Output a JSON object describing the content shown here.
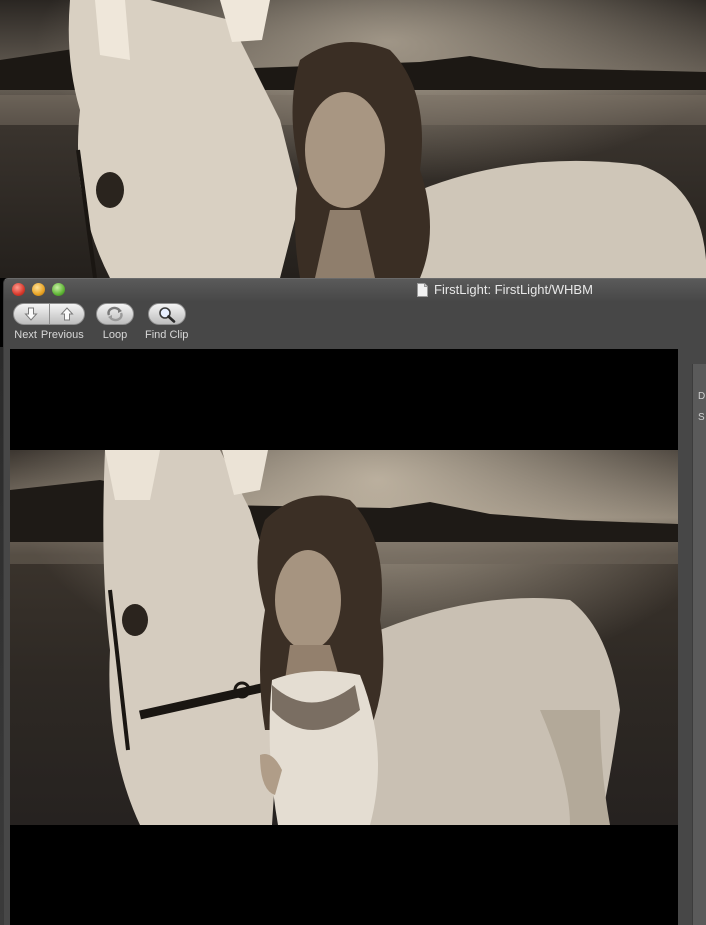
{
  "window": {
    "title": "FirstLight: FirstLight/WHBM"
  },
  "toolbar": {
    "next_label": "Next",
    "previous_label": "Previous",
    "loop_label": "Loop",
    "find_clip_label": "Find Clip"
  },
  "side_panel": {
    "partial_label_1": "D",
    "partial_label_2": "S"
  },
  "icons": {
    "close": "close-button-icon",
    "minimize": "minimize-button-icon",
    "maximize": "zoom-button-icon",
    "document": "document-icon",
    "next": "arrow-down-icon",
    "previous": "arrow-up-icon",
    "loop": "loop-icon",
    "find": "magnifier-icon"
  },
  "colors": {
    "window_bg": "#474747",
    "titlebar_text": "#e8e8e8",
    "toolbar_text": "#d8d8d8"
  }
}
